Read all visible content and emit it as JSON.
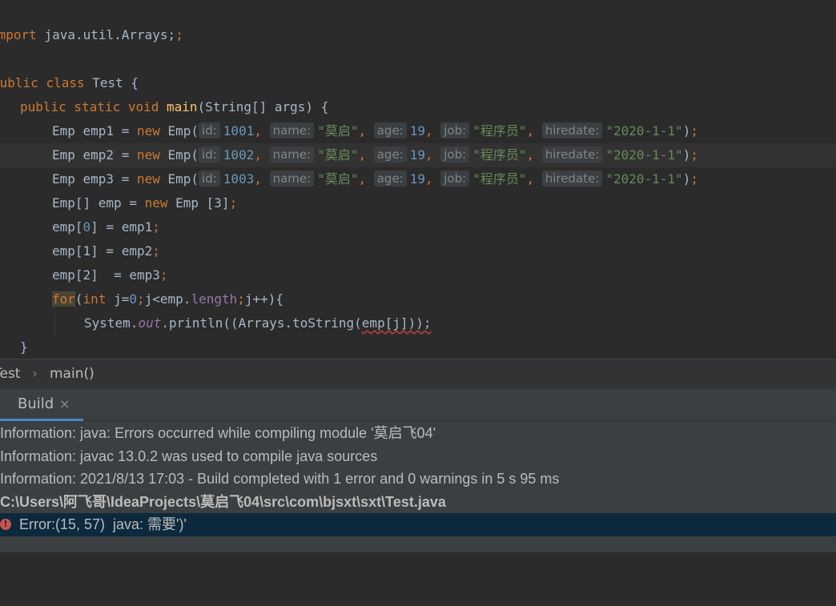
{
  "editor": {
    "lines": {
      "l0_kw": "import",
      "l0_rest": " java.util.Arrays;",
      "l2_kw1": "public",
      "l2_kw2": "class",
      "l2_rest": " Test {",
      "l3_kw": "public static void",
      "l3_fn": "main",
      "l3_rest": "(String[] args) {",
      "emp_rows": [
        {
          "decl": "Emp emp1 = ",
          "id": "1001"
        },
        {
          "decl": "Emp emp2 = ",
          "id": "1002"
        },
        {
          "decl": "Emp emp3 = ",
          "id": "1003"
        }
      ],
      "kw_new": "new",
      "ctor": " Emp(",
      "hint_id": "id:",
      "hint_name": "name:",
      "hint_age": "age:",
      "hint_job": "job:",
      "hint_hiredate": "hiredate:",
      "name_val": "\"莫启\"",
      "age_val": "19",
      "job_val": "\"程序员\"",
      "date_val": "\"2020-1-1\"",
      "l7_a": "Emp[] emp = ",
      "l7_b": " Emp [3]",
      "l8_a": "emp[",
      "l8_idx": "0",
      "l8_b": "] = emp1",
      "l9_a": "emp[1] = emp2",
      "l10_a": "emp[2]  = emp3",
      "l11_for": "for",
      "l11_int": "int",
      "l11_a": " j=",
      "l11_zero": "0",
      "l11_b": "j<emp.",
      "l11_len": "length",
      "l11_c": "j++){",
      "l12_a": "System.",
      "l12_out": "out",
      "l12_b": ".println((Arrays.toString(",
      "l12_err": "emp[j]));",
      "l13": "}"
    }
  },
  "breadcrumb": {
    "class": "Test",
    "sep": "›",
    "method": "main()"
  },
  "build": {
    "tab_label": "Build",
    "tab_close": "×",
    "messages": [
      "Information: java: Errors occurred while compiling module '莫启飞04'",
      "Information: javac 13.0.2 was used to compile java sources",
      "Information: 2021/8/13 17:03 - Build completed with 1 error and 0 warnings in 5 s 95 ms",
      "C:\\Users\\阿飞哥\\IdeaProjects\\莫启飞04\\src\\com\\bjsxt\\sxt\\Test.java"
    ],
    "error": "Error:(15, 57)  java: 需要')'",
    "error_icon": "!"
  },
  "colors": {
    "editor_bg": "#2b2b2b",
    "keyword": "#cc7832",
    "string": "#6a8759",
    "number": "#6897bb",
    "selection_blue": "#0d293e",
    "error_red": "#c75450",
    "tab_underline": "#4a88c7"
  }
}
